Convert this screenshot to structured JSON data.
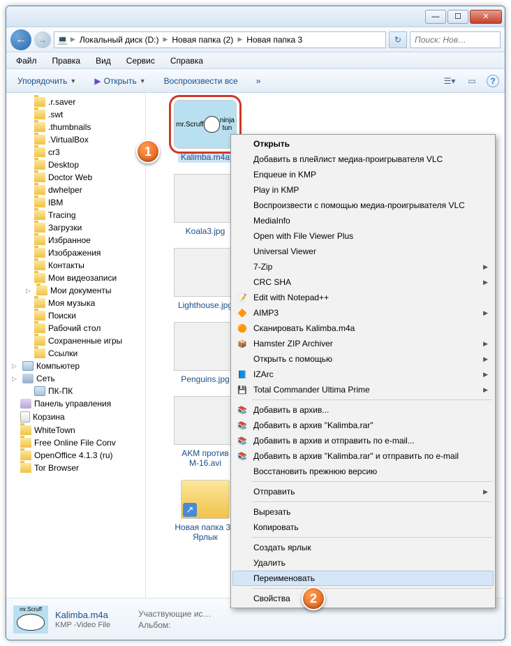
{
  "titlebar": {
    "min": "—",
    "max": "☐",
    "close": "✕"
  },
  "nav": {
    "crumbs": [
      "Локальный диск (D:)",
      "Новая папка (2)",
      "Новая папка 3"
    ],
    "search_placeholder": "Поиск: Нов…"
  },
  "menubar": [
    "Файл",
    "Правка",
    "Вид",
    "Сервис",
    "Справка"
  ],
  "toolbar": {
    "organize": "Упорядочить",
    "open": "Открыть",
    "playall": "Воспроизвести все",
    "more": "»"
  },
  "tree": [
    {
      "icon": "folder",
      "label": ".r.saver",
      "lv": 1
    },
    {
      "icon": "folder",
      "label": ".swt",
      "lv": 1
    },
    {
      "icon": "folder",
      "label": ".thumbnails",
      "lv": 1
    },
    {
      "icon": "folder",
      "label": ".VirtualBox",
      "lv": 1
    },
    {
      "icon": "folder",
      "label": "cr3",
      "lv": 1
    },
    {
      "icon": "folder",
      "label": "Desktop",
      "lv": 1
    },
    {
      "icon": "folder",
      "label": "Doctor Web",
      "lv": 1
    },
    {
      "icon": "folder",
      "label": "dwhelper",
      "lv": 1
    },
    {
      "icon": "folder",
      "label": "IBM",
      "lv": 1
    },
    {
      "icon": "folder",
      "label": "Tracing",
      "lv": 1
    },
    {
      "icon": "folder",
      "label": "Загрузки",
      "lv": 1
    },
    {
      "icon": "folder",
      "label": "Избранное",
      "lv": 1
    },
    {
      "icon": "folder",
      "label": "Изображения",
      "lv": 1
    },
    {
      "icon": "folder",
      "label": "Контакты",
      "lv": 1
    },
    {
      "icon": "folder",
      "label": "Мои видеозаписи",
      "lv": 1
    },
    {
      "icon": "folder",
      "label": "Мои документы",
      "lv": 1,
      "exp": "▷"
    },
    {
      "icon": "folder",
      "label": "Моя музыка",
      "lv": 1
    },
    {
      "icon": "folder",
      "label": "Поиски",
      "lv": 1
    },
    {
      "icon": "folder",
      "label": "Рабочий стол",
      "lv": 1
    },
    {
      "icon": "folder",
      "label": "Сохраненные игры",
      "lv": 1
    },
    {
      "icon": "folder",
      "label": "Ссылки",
      "lv": 1
    },
    {
      "icon": "computer",
      "label": "Компьютер",
      "lv": 0,
      "exp": "▷"
    },
    {
      "icon": "network",
      "label": "Сеть",
      "lv": 0,
      "exp": "▷"
    },
    {
      "icon": "computer",
      "label": "ПК-ПК",
      "lv": 1
    },
    {
      "icon": "panel",
      "label": "Панель управления",
      "lv": 0
    },
    {
      "icon": "bin",
      "label": "Корзина",
      "lv": 0
    },
    {
      "icon": "folder",
      "label": "WhiteTown",
      "lv": 0
    },
    {
      "icon": "folder",
      "label": "Free Online File Conv",
      "lv": 0
    },
    {
      "icon": "folder",
      "label": "OpenOffice 4.1.3 (ru)",
      "lv": 0
    },
    {
      "icon": "folder",
      "label": "Tor Browser",
      "lv": 0
    }
  ],
  "thumbs": [
    {
      "label": "Kalimba.m4a",
      "cls": "scruff",
      "sel": true,
      "txt1": "mr.Scruff",
      "txt2": "ninja tun"
    },
    {
      "label": "Koala3.jpg",
      "cls": "koala"
    },
    {
      "label": "Lighthouse.jpg",
      "cls": "light"
    },
    {
      "label": "Penguins.jpg",
      "cls": "peng"
    },
    {
      "label": "AKM против М-16.avi",
      "cls": "face"
    },
    {
      "label": "Новая папка 3 - Ярлык",
      "cls": "fold"
    }
  ],
  "details": {
    "name": "Kalimba.m4a",
    "type": "KMP -Video File",
    "meta1": "Участвующие ис…",
    "meta2": "Альбом:"
  },
  "ctx": [
    {
      "t": "item",
      "label": "Открыть",
      "bold": true
    },
    {
      "t": "item",
      "label": "Добавить в плейлист медиа-проигрывателя VLC"
    },
    {
      "t": "item",
      "label": "Enqueue in KMP"
    },
    {
      "t": "item",
      "label": "Play in KMP"
    },
    {
      "t": "item",
      "label": "Воспроизвести с помощью медиа-проигрывателя VLC"
    },
    {
      "t": "item",
      "label": "MediaInfo"
    },
    {
      "t": "item",
      "label": "Open with File Viewer Plus"
    },
    {
      "t": "item",
      "label": "Universal Viewer"
    },
    {
      "t": "item",
      "label": "7-Zip",
      "sub": true
    },
    {
      "t": "item",
      "label": "CRC SHA",
      "sub": true
    },
    {
      "t": "item",
      "label": "Edit with Notepad++",
      "icon": "📝"
    },
    {
      "t": "item",
      "label": "AIMP3",
      "icon": "🔶",
      "sub": true
    },
    {
      "t": "item",
      "label": "Сканировать Kalimba.m4a",
      "icon": "🟠"
    },
    {
      "t": "item",
      "label": "Hamster ZIP Archiver",
      "icon": "📦",
      "sub": true
    },
    {
      "t": "item",
      "label": "Открыть с помощью",
      "sub": true
    },
    {
      "t": "item",
      "label": "IZArc",
      "icon": "📘",
      "sub": true
    },
    {
      "t": "item",
      "label": "Total Commander Ultima Prime",
      "icon": "💾",
      "sub": true
    },
    {
      "t": "sep"
    },
    {
      "t": "item",
      "label": "Добавить в архив...",
      "icon": "📚"
    },
    {
      "t": "item",
      "label": "Добавить в архив \"Kalimba.rar\"",
      "icon": "📚"
    },
    {
      "t": "item",
      "label": "Добавить в архив и отправить по e-mail...",
      "icon": "📚"
    },
    {
      "t": "item",
      "label": "Добавить в архив \"Kalimba.rar\" и отправить по e-mail",
      "icon": "📚"
    },
    {
      "t": "item",
      "label": "Восстановить прежнюю версию"
    },
    {
      "t": "sep"
    },
    {
      "t": "item",
      "label": "Отправить",
      "sub": true
    },
    {
      "t": "sep"
    },
    {
      "t": "item",
      "label": "Вырезать"
    },
    {
      "t": "item",
      "label": "Копировать"
    },
    {
      "t": "sep"
    },
    {
      "t": "item",
      "label": "Создать ярлык"
    },
    {
      "t": "item",
      "label": "Удалить"
    },
    {
      "t": "item",
      "label": "Переименовать",
      "hl": true
    },
    {
      "t": "sep"
    },
    {
      "t": "item",
      "label": "Свойства"
    }
  ],
  "badges": {
    "b1": "1",
    "b2": "2"
  }
}
